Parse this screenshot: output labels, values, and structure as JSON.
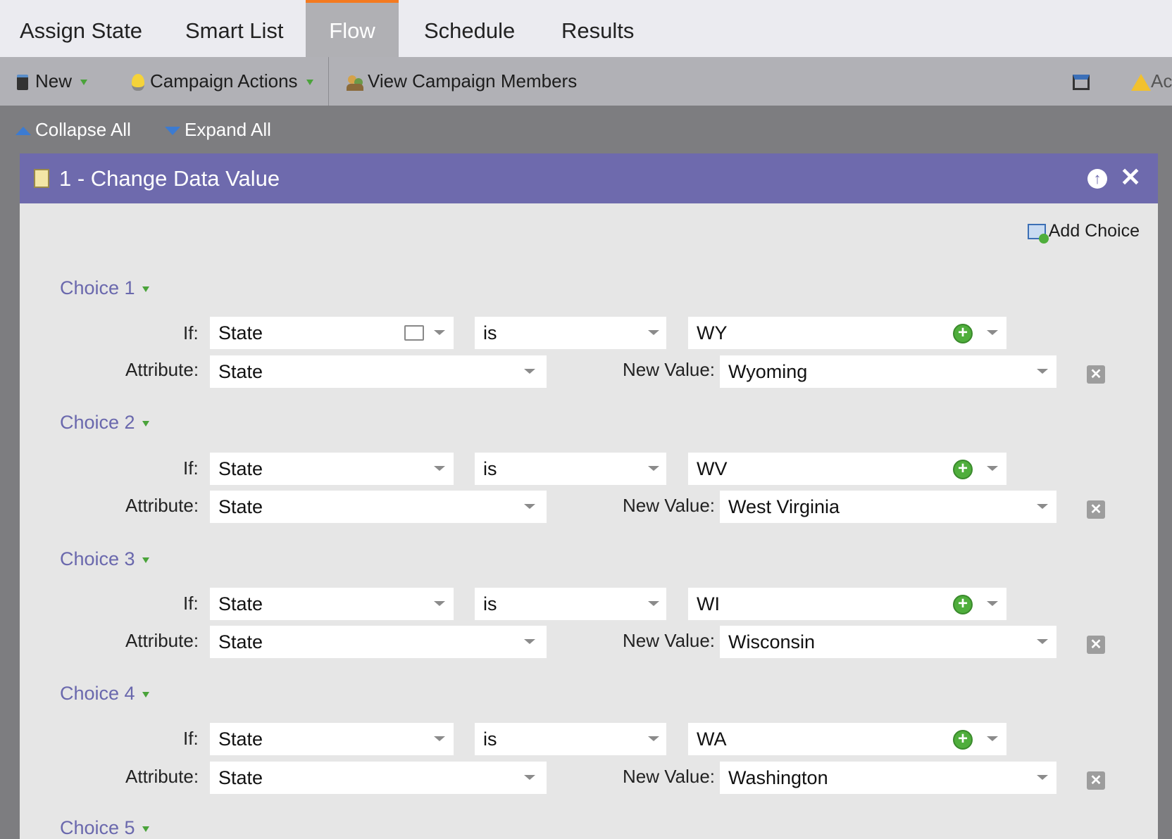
{
  "tabs": [
    {
      "label": "Assign State",
      "active": false
    },
    {
      "label": "Smart List",
      "active": false
    },
    {
      "label": "Flow",
      "active": true
    },
    {
      "label": "Schedule",
      "active": false
    },
    {
      "label": "Results",
      "active": false
    }
  ],
  "toolbar": {
    "new_label": "New",
    "campaign_actions_label": "Campaign Actions",
    "view_members_label": "View Campaign Members",
    "truncated_label": "Ac"
  },
  "collapse_bar": {
    "collapse_label": "Collapse All",
    "expand_label": "Expand All"
  },
  "panel": {
    "title": "1 - Change Data Value",
    "add_choice_label": "Add Choice",
    "if_label": "If:",
    "attribute_label": "Attribute:",
    "new_value_label": "New Value:",
    "choices": [
      {
        "title": "Choice 1",
        "if_field": "State",
        "operator": "is",
        "value": "WY",
        "attribute": "State",
        "new_value": "Wyoming"
      },
      {
        "title": "Choice 2",
        "if_field": "State",
        "operator": "is",
        "value": "WV",
        "attribute": "State",
        "new_value": "West Virginia"
      },
      {
        "title": "Choice 3",
        "if_field": "State",
        "operator": "is",
        "value": "WI",
        "attribute": "State",
        "new_value": "Wisconsin"
      },
      {
        "title": "Choice 4",
        "if_field": "State",
        "operator": "is",
        "value": "WA",
        "attribute": "State",
        "new_value": "Washington"
      },
      {
        "title": "Choice 5"
      }
    ]
  },
  "colors": {
    "panel_header": "#6e6aad",
    "active_tab_accent": "#f47a20",
    "choice_title": "#6a68ad",
    "add_icon_green": "#4fae3c"
  }
}
